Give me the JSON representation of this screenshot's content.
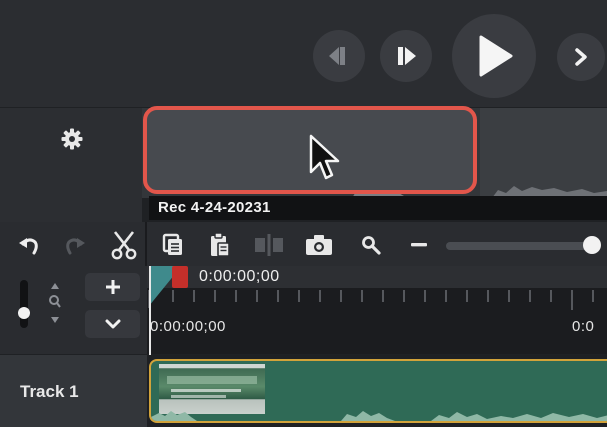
{
  "clip": {
    "name": "Rec 4-24-20231"
  },
  "playhead": {
    "time": "0:00:00;00"
  },
  "ruler": {
    "start": "0:00:00;00",
    "next": "0:0"
  },
  "tracks": [
    {
      "label": "Track 1"
    }
  ],
  "colors": {
    "accent_red": "#e2564b",
    "clip_border": "#d2a33a",
    "track_green": "#2f6a56",
    "panel_dark": "#2a2c30"
  },
  "icons": {
    "settings": "gear-icon",
    "undo": "undo-icon",
    "redo": "redo-icon",
    "cut": "scissors-icon",
    "copy": "copy-icon",
    "paste": "paste-icon",
    "split": "split-icon",
    "snapshot": "camera-icon",
    "zoom": "magnifier-icon",
    "zoom_out": "minus-icon",
    "add_track": "plus-icon",
    "collapse": "chevron-down-icon",
    "step_back": "step-back-icon",
    "step_forward": "step-forward-icon",
    "play": "play-icon",
    "next": "chevron-right-icon"
  },
  "zoom_slider": {
    "level": 0.95
  }
}
